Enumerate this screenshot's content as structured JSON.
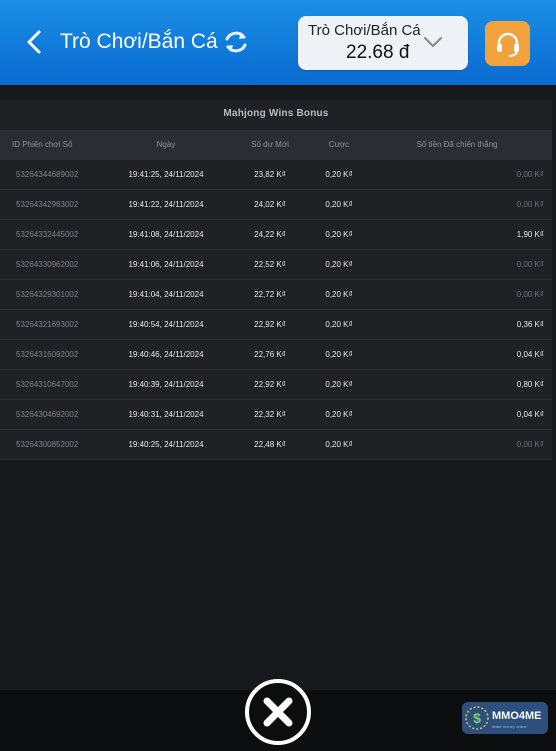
{
  "header": {
    "title": "Trò Chơi/Bắn Cá",
    "selector_name": "Trò Chơi/Bắn Cá",
    "selector_amount": "22.68 đ",
    "bg_color": "#0a6ad0",
    "support_color": "#f2a23c"
  },
  "panel": {
    "title": "Mahjong Wins Bonus",
    "columns": [
      "ID Phiên chơi Số",
      "Ngày",
      "Số dư Mới",
      "Cược",
      "Số tiền Đã chiến thắng"
    ],
    "rows": [
      {
        "id": "53264344689002",
        "date": "19:41:25, 24/11/2024",
        "balance": "23,82 K₫",
        "bet": "0,20 K₫",
        "win": "0,00 K₫",
        "positive": false
      },
      {
        "id": "53264342983002",
        "date": "19:41:22, 24/11/2024",
        "balance": "24,02 K₫",
        "bet": "0,20 K₫",
        "win": "0,00 K₫",
        "positive": false
      },
      {
        "id": "53264332445002",
        "date": "19:41:08, 24/11/2024",
        "balance": "24,22 K₫",
        "bet": "0,20 K₫",
        "win": "1,90 K₫",
        "positive": true
      },
      {
        "id": "53264330962002",
        "date": "19:41:06, 24/11/2024",
        "balance": "22,52 K₫",
        "bet": "0,20 K₫",
        "win": "0,00 K₫",
        "positive": false
      },
      {
        "id": "53264329301002",
        "date": "19:41:04, 24/11/2024",
        "balance": "22,72 K₫",
        "bet": "0,20 K₫",
        "win": "0,00 K₫",
        "positive": false
      },
      {
        "id": "53264321693002",
        "date": "19:40:54, 24/11/2024",
        "balance": "22,92 K₫",
        "bet": "0,20 K₫",
        "win": "0,36 K₫",
        "positive": true
      },
      {
        "id": "53264316092002",
        "date": "19:40:46, 24/11/2024",
        "balance": "22,76 K₫",
        "bet": "0,20 K₫",
        "win": "0,04 K₫",
        "positive": true
      },
      {
        "id": "53264310647002",
        "date": "19:40:39, 24/11/2024",
        "balance": "22,92 K₫",
        "bet": "0,20 K₫",
        "win": "0,80 K₫",
        "positive": true
      },
      {
        "id": "53264304692002",
        "date": "19:40:31, 24/11/2024",
        "balance": "22,32 K₫",
        "bet": "0,20 K₫",
        "win": "0,04 K₫",
        "positive": true
      },
      {
        "id": "53264300852002",
        "date": "19:40:25, 24/11/2024",
        "balance": "22,48 K₫",
        "bet": "0,20 K₫",
        "win": "0,00 K₫",
        "positive": false
      }
    ]
  },
  "icons": {
    "back": "chevron-left-icon",
    "refresh": "refresh-icon",
    "dropdown": "chevron-down-icon",
    "support": "headset-icon",
    "close": "close-icon"
  },
  "logo": {
    "text": "MMO4ME",
    "sub": "Make money online"
  }
}
